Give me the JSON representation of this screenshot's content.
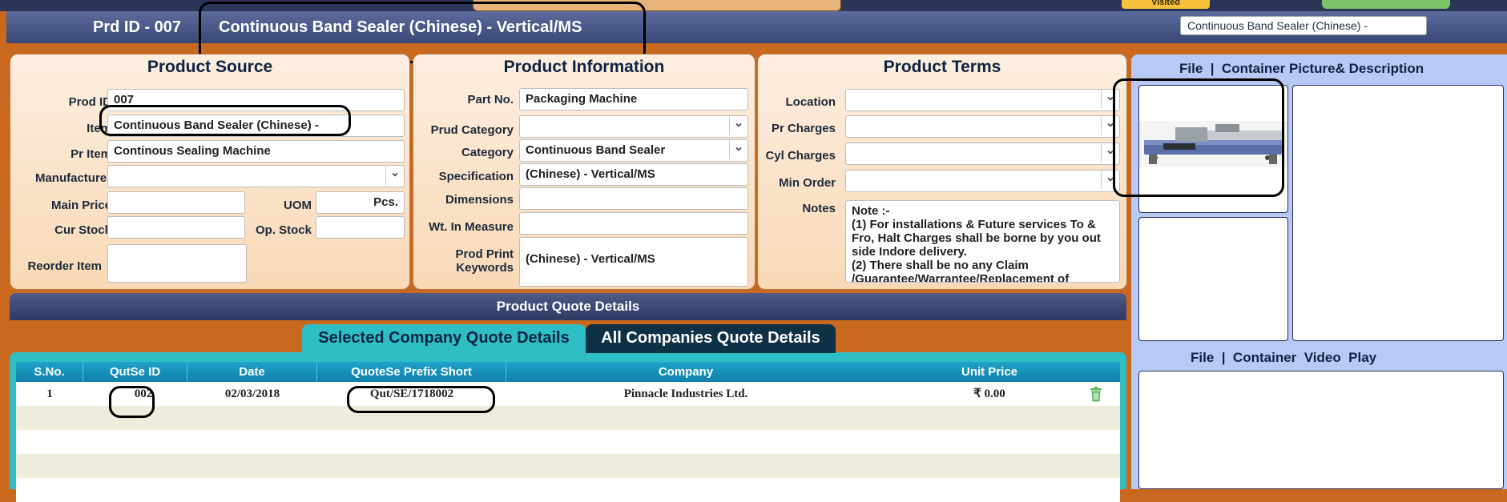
{
  "top": {
    "visited_label": "Visited"
  },
  "header": {
    "prd_id": "Prd ID - 007",
    "title": "Continuous Band Sealer (Chinese) - Vertical/MS",
    "search_value": "Continuous Band Sealer (Chinese) -"
  },
  "source": {
    "title": "Product Source",
    "prod_id_label": "Prod ID",
    "prod_id": "007",
    "item_label": "Item",
    "item": "Continuous Band Sealer (Chinese) -",
    "pr_item_label": "Pr Item",
    "pr_item": "Continous Sealing Machine",
    "manufacturer_label": "Manufacturer",
    "manufacturer": "",
    "main_price_label": "Main Price",
    "main_price": "",
    "uom_label": "UOM",
    "uom": "Pcs.",
    "cur_stock_label": "Cur Stock",
    "cur_stock": "",
    "op_stock_label": "Op. Stock",
    "op_stock": "",
    "reorder_label": "Reorder Item",
    "reorder": ""
  },
  "info": {
    "title": "Product Information",
    "part_no_label": "Part No.",
    "part_no": "Packaging Machine",
    "prud_category_label": "Prud Category",
    "prud_category": "",
    "category_label": "Category",
    "category": "Continuous Band Sealer",
    "specification_label": "Specification",
    "specification": "(Chinese) - Vertical/MS",
    "dimensions_label": "Dimensions",
    "dimensions": "",
    "wt_label": "Wt. In Measure",
    "wt": "",
    "keywords_label_1": "Prod Print",
    "keywords_label_2": "Keywords",
    "keywords": "(Chinese) - Vertical/MS"
  },
  "terms": {
    "title": "Product Terms",
    "location_label": "Location",
    "location": "",
    "pr_charges_label": "Pr Charges",
    "pr_charges": "",
    "cyl_charges_label": "Cyl Charges",
    "cyl_charges": "",
    "min_order_label": "Min Order",
    "min_order": "",
    "notes_label": "Notes",
    "notes_lines": [
      "Note :-",
      "(1) For installations & Future services To &",
      "Fro, Halt Charges shall be borne by you out",
      "side Indore delivery.",
      "(2) There shall be no any Claim",
      "/Guarantee/Warrantee/Replacement of"
    ]
  },
  "media": {
    "picture_title": "File  |  Container Picture& Description",
    "video_title": "File  |  Container  Video  Play"
  },
  "quote": {
    "bar_title": "Product Quote Details",
    "tab_selected": "Selected Company Quote Details",
    "tab_all": "All Companies Quote Details",
    "columns": [
      "S.No.",
      "QutSe ID",
      "Date",
      "QuoteSe Prefix Short",
      "Company",
      "Unit Price"
    ],
    "rows": [
      {
        "sno": "1",
        "qutse_id": "002",
        "date": "02/03/2018",
        "prefix": "Qut/SE/1718002",
        "company": "Pinnacle Industries Ltd.",
        "price": "₹ 0.00"
      }
    ]
  }
}
